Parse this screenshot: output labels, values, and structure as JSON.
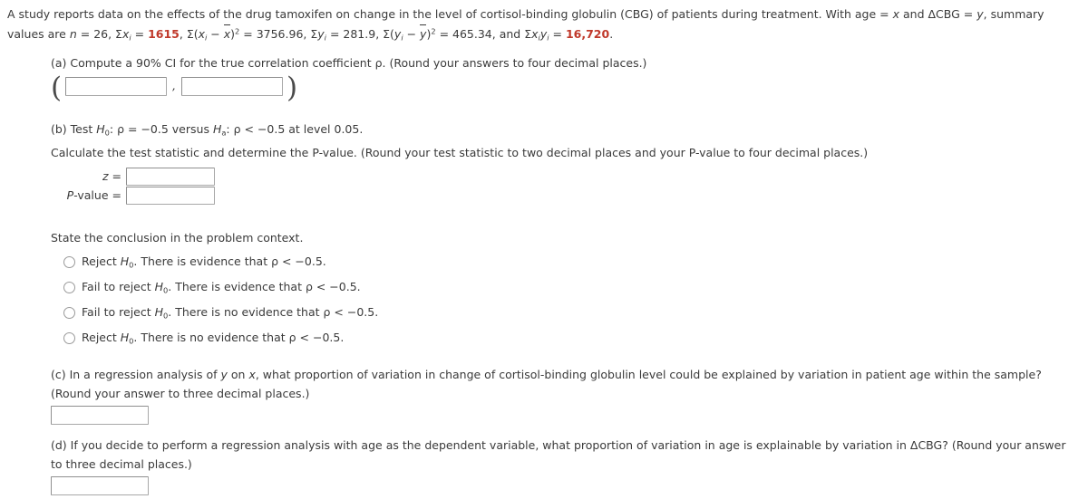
{
  "problem": {
    "intro_line1_pre": "A study reports data on the effects of the drug tamoxifen on change in the level of cortisol-binding globulin (CBG) of patients during treatment. With age = ",
    "intro_var_x": "x",
    "intro_line1_mid": " and ΔCBG = ",
    "intro_var_y": "y",
    "intro_line1_post": ", summary",
    "intro_line2_lead": "values are ",
    "n_symbol": "n",
    "n_value": "26",
    "sum_x_label": "Σx",
    "sum_x_value": "1615",
    "ssx_label": "Σ(x",
    "ssx_value": "3756.96",
    "sum_y_label": "Σy",
    "sum_y_value": "281.9",
    "ssy_label": "Σ(y",
    "ssy_value": "465.34",
    "and_word": "and",
    "sum_xy_label": "Σx",
    "sum_xy_value": "16,720",
    "period": "."
  },
  "part_a": {
    "prompt": "(a) Compute a 90% CI for the true correlation coefficient ρ. (Round your answers to four decimal places.)",
    "open_paren": "(",
    "comma": ",",
    "close_paren": ")",
    "lower_value": "",
    "upper_value": "",
    "lower_placeholder": "",
    "upper_placeholder": ""
  },
  "part_b": {
    "prompt_pre": "(b) Test ",
    "h0_symbol": "H",
    "h0_sub": "0",
    "h0_statement": ": ρ = −0.5 versus ",
    "ha_symbol": "H",
    "ha_sub": "a",
    "ha_statement": ": ρ < −0.5 at level 0.05.",
    "instruction": "Calculate the test statistic and determine the P-value. (Round your test statistic to two decimal places and your P-value to four decimal places.)",
    "z_label": "z",
    "z_equals": "=",
    "z_value": "",
    "pvalue_label": "P-value",
    "pvalue_equals": "=",
    "pvalue_value": "",
    "conclusion_prompt": "State the conclusion in the problem context.",
    "options": [
      {
        "id": "option-reject-evidence",
        "lead": "Reject ",
        "h_symbol": "H",
        "h_sub": "0",
        "tail": ". There is evidence that ρ < −0.5.",
        "selected": false
      },
      {
        "id": "option-fail-reject-evidence",
        "lead": "Fail to reject ",
        "h_symbol": "H",
        "h_sub": "0",
        "tail": ". There is evidence that ρ < −0.5.",
        "selected": false
      },
      {
        "id": "option-fail-reject-no-evidence",
        "lead": "Fail to reject ",
        "h_symbol": "H",
        "h_sub": "0",
        "tail": ". There is no evidence that ρ < −0.5.",
        "selected": false
      },
      {
        "id": "option-reject-no-evidence",
        "lead": "Reject ",
        "h_symbol": "H",
        "h_sub": "0",
        "tail": ". There is no evidence that ρ < −0.5.",
        "selected": false
      }
    ]
  },
  "part_c": {
    "prompt_line1_pre": "(c) In a regression analysis of ",
    "var_y": "y",
    "prompt_on": " on ",
    "var_x": "x",
    "prompt_line1_post": ", what proportion of variation in change of cortisol-binding globulin level could be explained by variation in patient age within the sample?",
    "prompt_line2": "(Round your answer to three decimal places.)",
    "answer_value": "",
    "answer_placeholder": ""
  },
  "part_d": {
    "prompt_line1": "(d) If you decide to perform a regression analysis with age as the dependent variable, what proportion of variation in age is explainable by variation in ΔCBG? (Round your answer",
    "prompt_line2": "to three decimal places.)",
    "answer_value": "",
    "answer_placeholder": ""
  },
  "colors": {
    "text": "#3a3a3a",
    "highlight_red": "#c0392b",
    "input_border": "#a8a8a8",
    "radio_border": "#9a9a9a"
  }
}
